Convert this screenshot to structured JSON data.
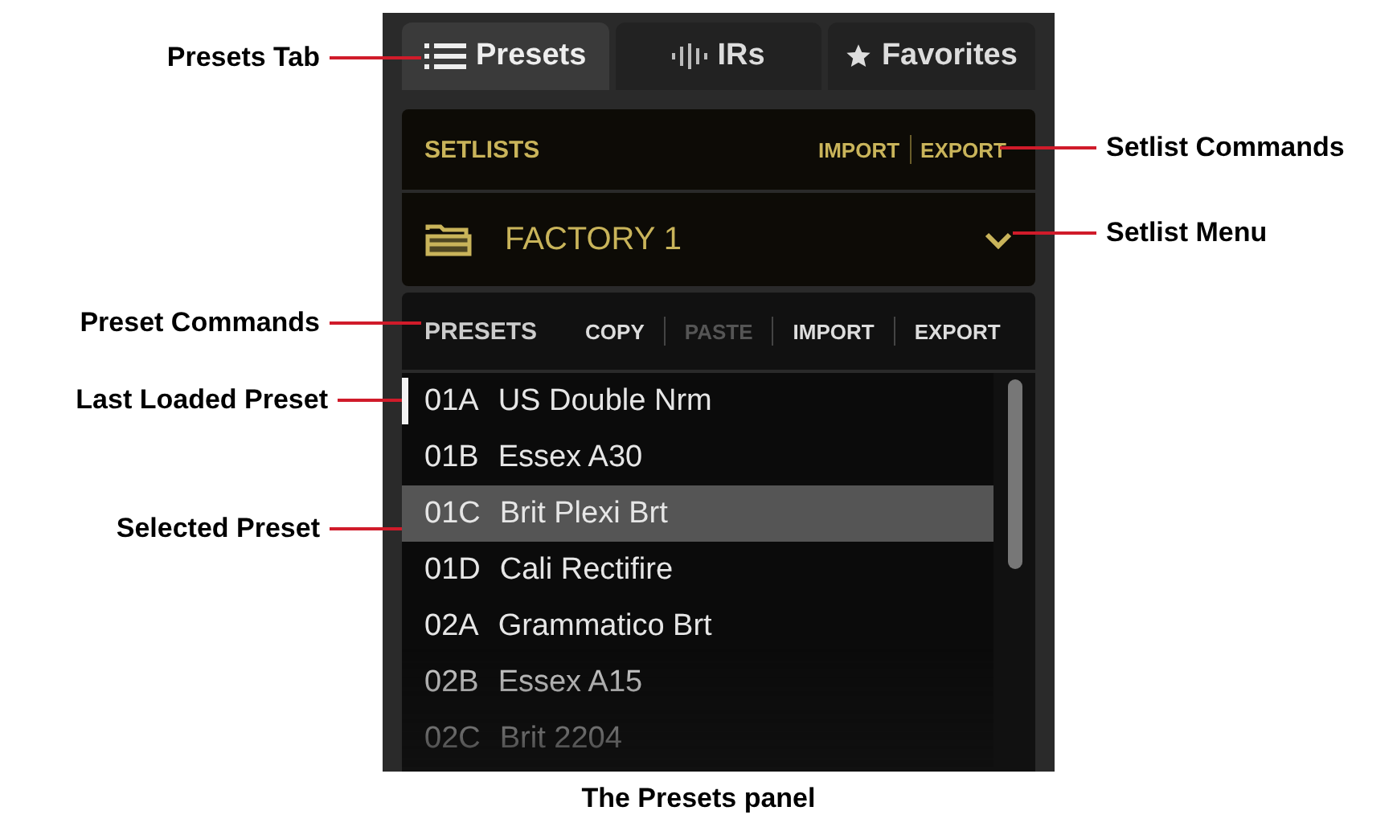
{
  "tabs": [
    {
      "label": "Presets",
      "kind": "list",
      "selected": true
    },
    {
      "label": "IRs",
      "kind": "wave",
      "selected": false
    },
    {
      "label": "Favorites",
      "kind": "star",
      "selected": false
    }
  ],
  "setlists": {
    "title": "SETLISTS",
    "commands": [
      {
        "label": "IMPORT",
        "disabled": false
      },
      {
        "label": "EXPORT",
        "disabled": false
      }
    ],
    "current": "FACTORY 1"
  },
  "presets": {
    "title": "PRESETS",
    "commands": [
      {
        "label": "COPY",
        "disabled": false
      },
      {
        "label": "PASTE",
        "disabled": true
      },
      {
        "label": "IMPORT",
        "disabled": false
      },
      {
        "label": "EXPORT",
        "disabled": false
      }
    ],
    "items": [
      {
        "slot": "01A",
        "name": "US Double Nrm",
        "selected": false,
        "last_loaded": true
      },
      {
        "slot": "01B",
        "name": "Essex A30",
        "selected": false,
        "last_loaded": false
      },
      {
        "slot": "01C",
        "name": "Brit Plexi Brt",
        "selected": true,
        "last_loaded": false
      },
      {
        "slot": "01D",
        "name": "Cali Rectifire",
        "selected": false,
        "last_loaded": false
      },
      {
        "slot": "02A",
        "name": "Grammatico Brt",
        "selected": false,
        "last_loaded": false
      },
      {
        "slot": "02B",
        "name": "Essex A15",
        "selected": false,
        "last_loaded": false
      },
      {
        "slot": "02C",
        "name": "Brit 2204",
        "selected": false,
        "last_loaded": false
      }
    ]
  },
  "callouts": [
    {
      "label": "Presets Tab",
      "kind": "left"
    },
    {
      "label": "Setlist Commands",
      "kind": "right"
    },
    {
      "label": "Setlist Menu",
      "kind": "right"
    },
    {
      "label": "Preset Commands",
      "kind": "left"
    },
    {
      "label": "Last Loaded Preset",
      "kind": "left"
    },
    {
      "label": "Selected Preset",
      "kind": "left"
    }
  ],
  "caption": "The Presets panel"
}
